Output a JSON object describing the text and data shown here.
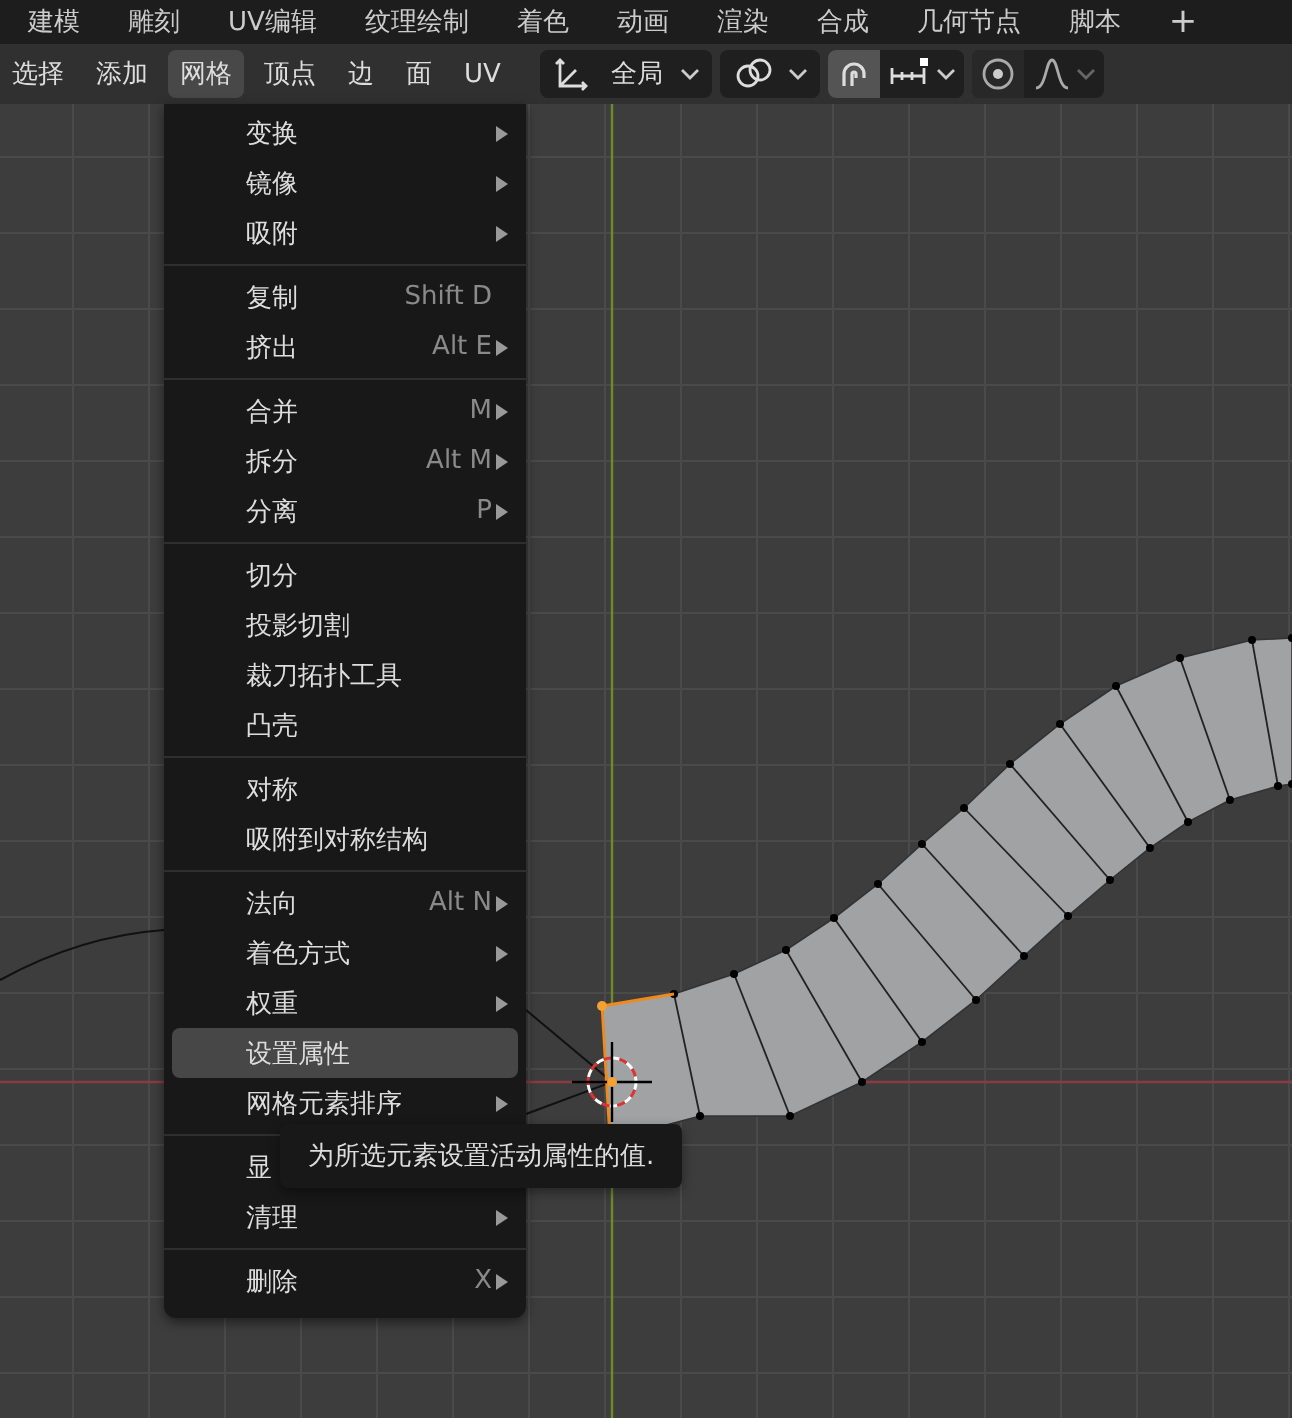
{
  "workspace_tabs": [
    {
      "label": "建模",
      "selected": false
    },
    {
      "label": "雕刻",
      "selected": false
    },
    {
      "label": "UV编辑",
      "selected": false
    },
    {
      "label": "纹理绘制",
      "selected": false
    },
    {
      "label": "着色",
      "selected": false
    },
    {
      "label": "动画",
      "selected": false
    },
    {
      "label": "渲染",
      "selected": false
    },
    {
      "label": "合成",
      "selected": false
    },
    {
      "label": "几何节点",
      "selected": false
    },
    {
      "label": "脚本",
      "selected": false
    }
  ],
  "add_workspace": "+",
  "header_menus": [
    {
      "label": "选择",
      "selected": false
    },
    {
      "label": "添加",
      "selected": false
    },
    {
      "label": "网格",
      "selected": true
    },
    {
      "label": "顶点",
      "selected": false
    },
    {
      "label": "边",
      "selected": false
    },
    {
      "label": "面",
      "selected": false
    },
    {
      "label": "UV",
      "selected": false
    }
  ],
  "orientation_dropdown": {
    "value": "全局"
  },
  "snap_toggle": {
    "on": true
  },
  "proportional_toggle": {
    "on": false
  },
  "mesh_menu": {
    "groups": [
      [
        {
          "label": "变换",
          "submenu": true,
          "selected": false
        },
        {
          "label": "镜像",
          "submenu": true,
          "selected": false
        },
        {
          "label": "吸附",
          "submenu": true,
          "selected": false
        }
      ],
      [
        {
          "label": "复制",
          "shortcut": "Shift D",
          "submenu": false,
          "selected": false
        },
        {
          "label": "挤出",
          "shortcut": "Alt E",
          "submenu": true,
          "selected": false
        }
      ],
      [
        {
          "label": "合并",
          "shortcut": "M",
          "submenu": true,
          "selected": false
        },
        {
          "label": "拆分",
          "shortcut": "Alt M",
          "submenu": true,
          "selected": false
        },
        {
          "label": "分离",
          "shortcut": "P",
          "submenu": true,
          "selected": false
        }
      ],
      [
        {
          "label": "切分",
          "submenu": false,
          "selected": false
        },
        {
          "label": "投影切割",
          "submenu": false,
          "selected": false
        },
        {
          "label": "裁刀拓扑工具",
          "submenu": false,
          "selected": false
        },
        {
          "label": "凸壳",
          "submenu": false,
          "selected": false
        }
      ],
      [
        {
          "label": "对称",
          "submenu": false,
          "selected": false
        },
        {
          "label": "吸附到对称结构",
          "submenu": false,
          "selected": false
        }
      ],
      [
        {
          "label": "法向",
          "shortcut": "Alt N",
          "submenu": true,
          "selected": false
        },
        {
          "label": "着色方式",
          "submenu": true,
          "selected": false
        },
        {
          "label": "权重",
          "submenu": true,
          "selected": false
        },
        {
          "label": "设置属性",
          "submenu": false,
          "selected": true
        },
        {
          "label": "网格元素排序",
          "submenu": true,
          "selected": false
        }
      ],
      [
        {
          "label": "显",
          "submenu": false,
          "selected": false
        },
        {
          "label": "清理",
          "submenu": true,
          "selected": false
        }
      ],
      [
        {
          "label": "删除",
          "shortcut": "X",
          "submenu": true,
          "selected": false
        }
      ]
    ]
  },
  "tooltip": "为所选元素设置活动属性的值."
}
